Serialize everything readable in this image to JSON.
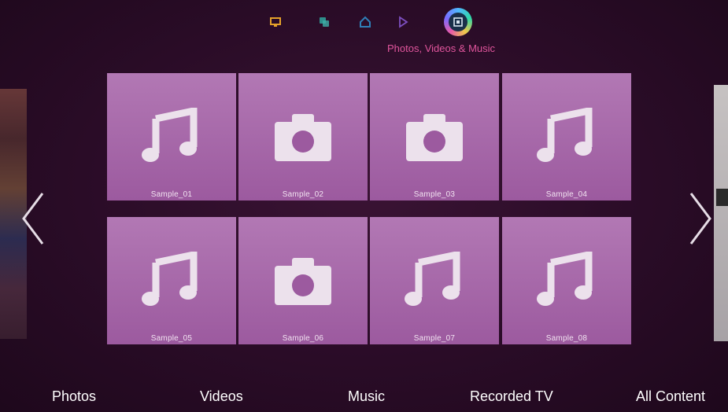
{
  "hub": {
    "icons": [
      "tv-icon",
      "apps-icon",
      "home-icon",
      "play-icon",
      "photos-videos-music-icon"
    ],
    "active_label": "Photos, Videos & Music"
  },
  "tiles": [
    {
      "name": "Sample_01",
      "icon": "music-note-icon"
    },
    {
      "name": "Sample_02",
      "icon": "camera-icon"
    },
    {
      "name": "Sample_03",
      "icon": "camera-icon"
    },
    {
      "name": "Sample_04",
      "icon": "music-note-icon"
    },
    {
      "name": "Sample_05",
      "icon": "music-note-icon"
    },
    {
      "name": "Sample_06",
      "icon": "camera-icon"
    },
    {
      "name": "Sample_07",
      "icon": "music-note-icon"
    },
    {
      "name": "Sample_08",
      "icon": "music-note-icon"
    }
  ],
  "categories": [
    "Photos",
    "Videos",
    "Music",
    "Recorded TV",
    "All Content"
  ],
  "colors": {
    "background": "#2a0c27",
    "tile": "#a865aa",
    "accent_label": "#e0559c"
  }
}
